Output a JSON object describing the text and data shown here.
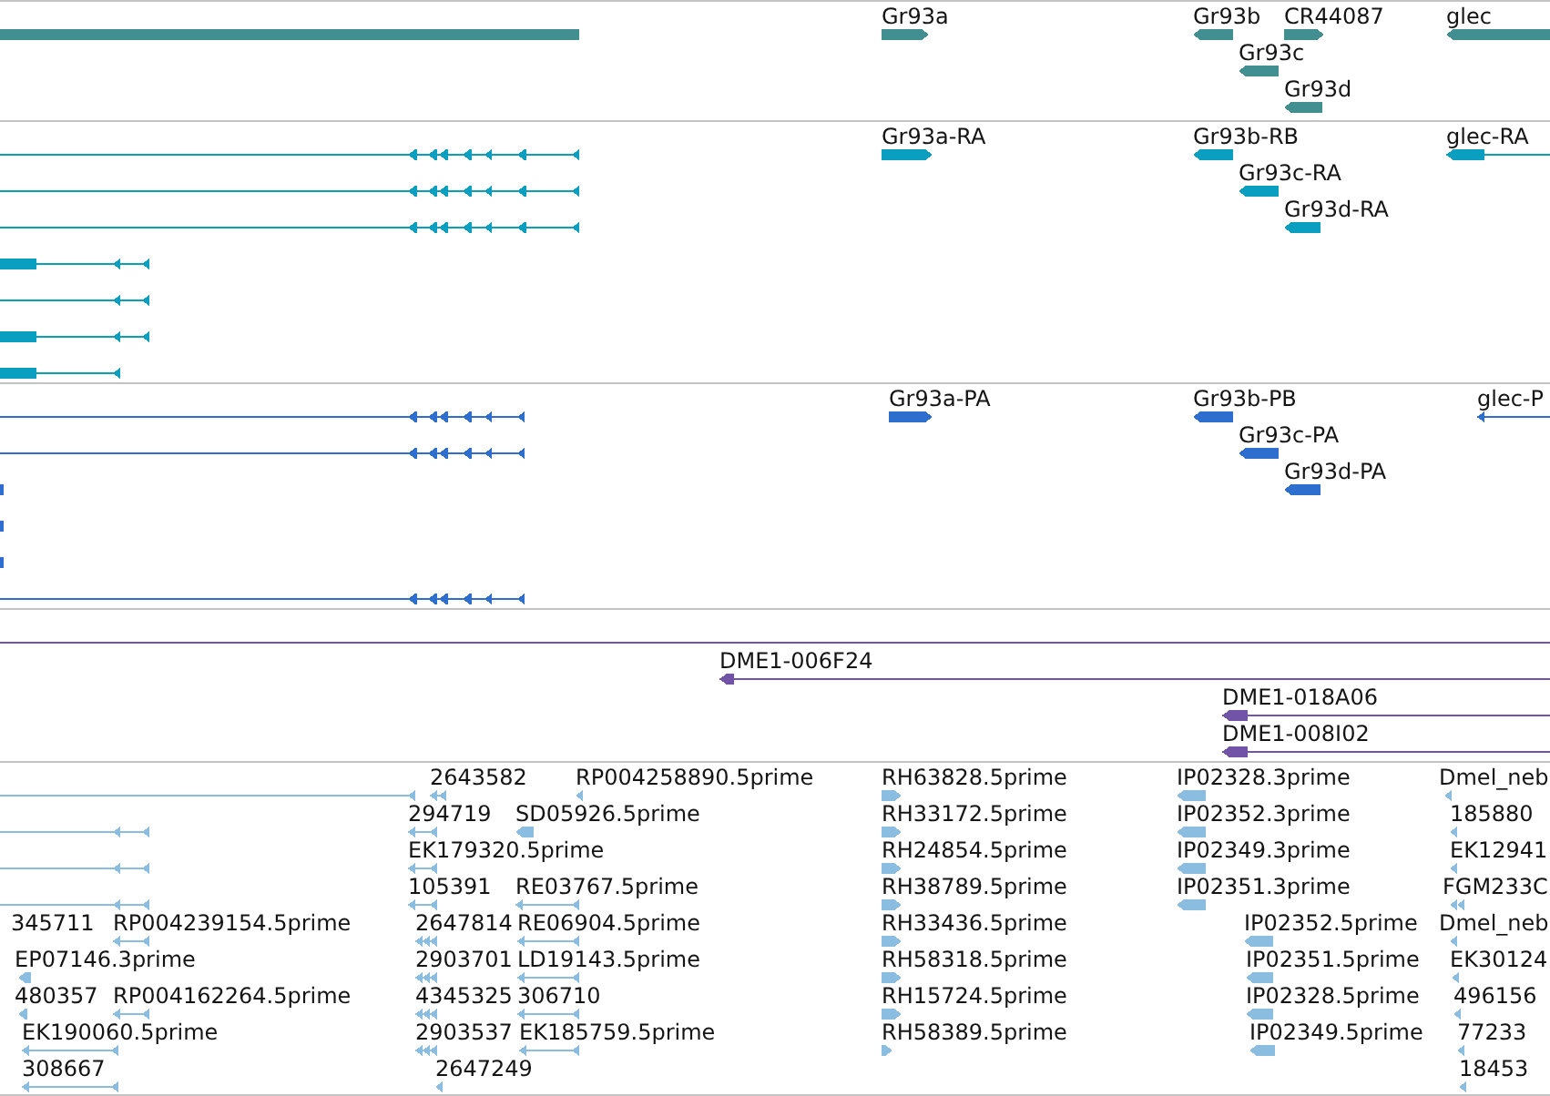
{
  "tracks": [
    {
      "color": "#418f91",
      "features": [
        {
          "reverse": true,
          "continues_left": true
        },
        {
          "label": "Gr93a",
          "reverse": false
        },
        {
          "label": "Gr93b",
          "reverse": true
        },
        {
          "label": "CR44087",
          "reverse": false
        },
        {
          "label": "glec",
          "reverse": true,
          "continues_right": true
        },
        {
          "label": "Gr93c",
          "reverse": true
        },
        {
          "label": "Gr93d",
          "reverse": true
        }
      ]
    },
    {
      "color": "#0a9ec0",
      "features": [
        {
          "reverse": true,
          "continues_left": true
        },
        {
          "label": "Gr93a-RA",
          "reverse": false
        },
        {
          "label": "Gr93b-RB",
          "reverse": true
        },
        {
          "label": "glec-RA",
          "reverse": true,
          "continues_right": true
        },
        {
          "reverse": true,
          "continues_left": true
        },
        {
          "label": "Gr93c-RA",
          "reverse": true
        },
        {
          "reverse": true,
          "continues_left": true
        },
        {
          "label": "Gr93d-RA",
          "reverse": true
        },
        {
          "reverse": true,
          "continues_left": true
        },
        {
          "reverse": true,
          "continues_left": true
        },
        {
          "reverse": true,
          "continues_left": true
        },
        {
          "reverse": true,
          "continues_left": true
        }
      ]
    },
    {
      "color": "#2e6ecf",
      "features": [
        {
          "reverse": true,
          "continues_left": true
        },
        {
          "label": "Gr93a-PA",
          "reverse": false
        },
        {
          "label": "Gr93b-PB",
          "reverse": true
        },
        {
          "label": "glec-P",
          "reverse": true,
          "continues_right": true
        },
        {
          "reverse": true,
          "continues_left": true
        },
        {
          "label": "Gr93c-PA",
          "reverse": true
        },
        {
          "reverse": true,
          "continues_left": true
        },
        {
          "label": "Gr93d-PA",
          "reverse": true
        },
        {
          "reverse": true,
          "continues_left": true
        },
        {
          "reverse": true,
          "continues_left": true
        },
        {
          "reverse": true,
          "continues_left": true
        }
      ]
    },
    {
      "color": "#7153a8",
      "features": [
        {
          "continues_left": true,
          "continues_right": true
        },
        {
          "label": "DME1-006F24",
          "reverse": true,
          "continues_right": true
        },
        {
          "label": "DME1-018A06",
          "reverse": true,
          "continues_right": true
        },
        {
          "label": "DME1-008I02",
          "reverse": true,
          "continues_right": true
        }
      ]
    },
    {
      "color": "#8abde0",
      "features": [
        {
          "reverse": true,
          "continues_left": true
        },
        {
          "label": "2643582",
          "reverse": true
        },
        {
          "label": "RP004258890.5prime",
          "reverse": true
        },
        {
          "label": "RH63828.5prime",
          "reverse": false
        },
        {
          "label": "IP02328.3prime",
          "reverse": true
        },
        {
          "label": "Dmel_neb",
          "reverse": true
        },
        {
          "reverse": true,
          "continues_left": true
        },
        {
          "label": "294719",
          "reverse": true
        },
        {
          "label": "SD05926.5prime",
          "reverse": true
        },
        {
          "label": "RH33172.5prime",
          "reverse": false
        },
        {
          "label": "IP02352.3prime",
          "reverse": true
        },
        {
          "label": "185880",
          "reverse": true
        },
        {
          "reverse": true,
          "continues_left": true
        },
        {
          "label": "EK179320.5prime",
          "reverse": true
        },
        {
          "label": "RH24854.5prime",
          "reverse": false
        },
        {
          "label": "IP02349.3prime",
          "reverse": true
        },
        {
          "label": "EK12941",
          "reverse": true
        },
        {
          "reverse": true,
          "continues_left": true
        },
        {
          "label": "105391",
          "reverse": true
        },
        {
          "label": "RE03767.5prime",
          "reverse": true
        },
        {
          "label": "RH38789.5prime",
          "reverse": false
        },
        {
          "label": "IP02351.3prime",
          "reverse": true
        },
        {
          "label": "FGM233C",
          "reverse": true
        },
        {
          "label": "345711"
        },
        {
          "label": "RP004239154.5prime",
          "reverse": true
        },
        {
          "label": "2647814",
          "reverse": true
        },
        {
          "label": "RE06904.5prime",
          "reverse": true
        },
        {
          "label": "RH33436.5prime",
          "reverse": false
        },
        {
          "label": "IP02352.5prime",
          "reverse": true
        },
        {
          "label": "Dmel_neb",
          "reverse": true
        },
        {
          "label": "EP07146.3prime",
          "reverse": true
        },
        {
          "label": "2903701",
          "reverse": true
        },
        {
          "label": "LD19143.5prime",
          "reverse": true
        },
        {
          "label": "RH58318.5prime",
          "reverse": false
        },
        {
          "label": "IP02351.5prime",
          "reverse": true
        },
        {
          "label": "EK30124",
          "reverse": true
        },
        {
          "label": "480357",
          "reverse": true
        },
        {
          "label": "RP004162264.5prime",
          "reverse": true
        },
        {
          "label": "4345325",
          "reverse": true
        },
        {
          "label": "306710",
          "reverse": true
        },
        {
          "label": "RH15724.5prime",
          "reverse": false
        },
        {
          "label": "IP02328.5prime",
          "reverse": true
        },
        {
          "label": "496156",
          "reverse": true
        },
        {
          "label": "EK190060.5prime",
          "reverse": true
        },
        {
          "label": "2903537",
          "reverse": true
        },
        {
          "label": "EK185759.5prime",
          "reverse": true
        },
        {
          "label": "RH58389.5prime",
          "reverse": false
        },
        {
          "label": "IP02349.5prime",
          "reverse": true
        },
        {
          "label": "77233",
          "reverse": true
        },
        {
          "label": "308667",
          "reverse": true
        },
        {
          "label": "2647249",
          "reverse": true
        },
        {
          "label": "18453",
          "reverse": true
        }
      ]
    }
  ]
}
